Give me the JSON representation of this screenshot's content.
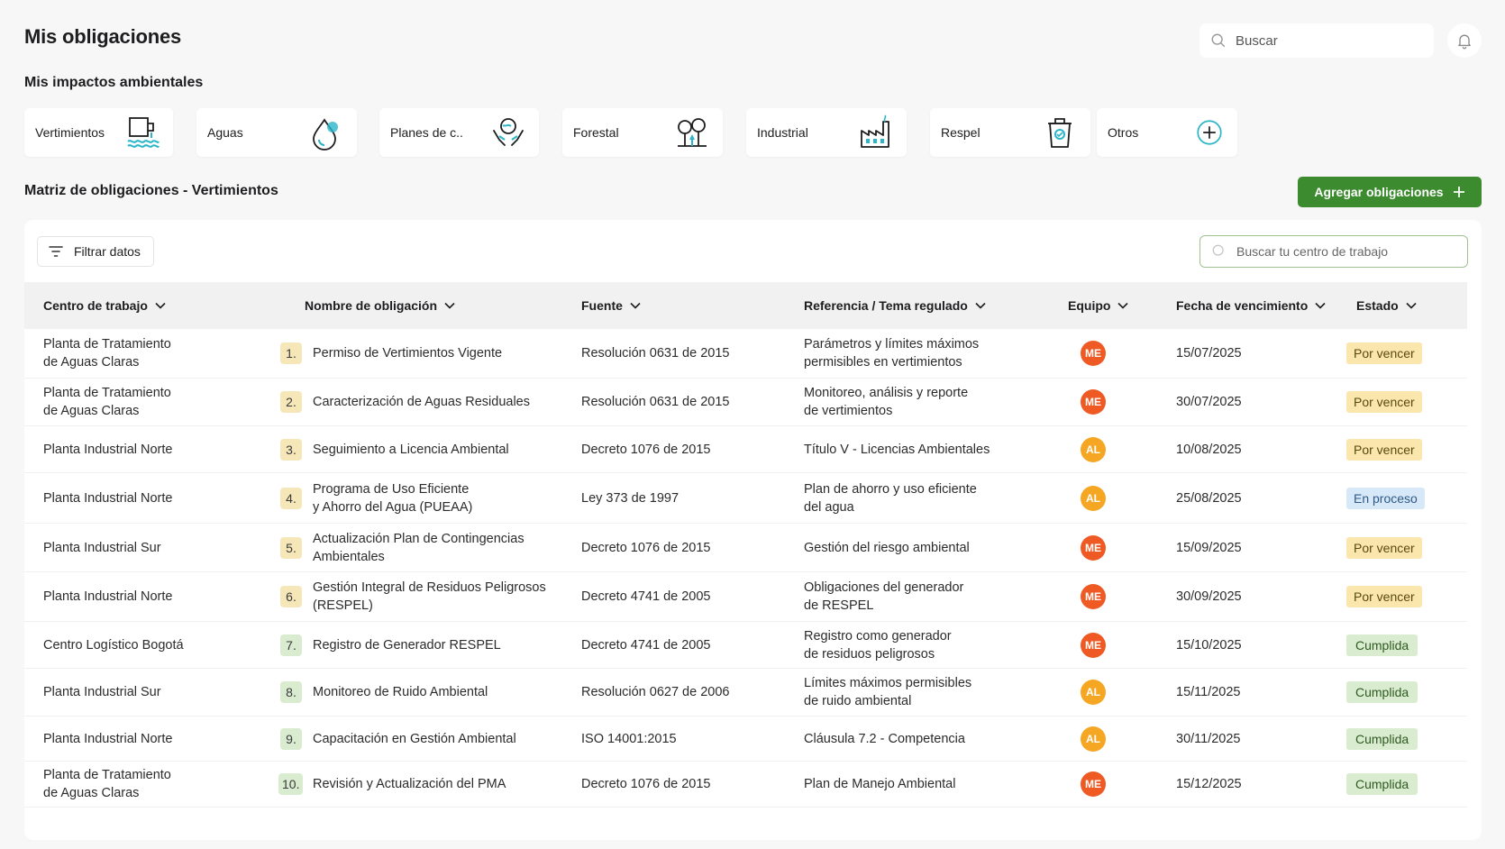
{
  "header": {
    "title": "Mis obligaciones",
    "search_placeholder": "Buscar"
  },
  "impacts": {
    "title": "Mis impactos ambientales",
    "tiles": [
      {
        "label": "Vertimientos",
        "icon": "water-discharge-icon"
      },
      {
        "label": "Aguas",
        "icon": "water-drop-icon"
      },
      {
        "label": "Planes de c..",
        "icon": "hands-globe-icon"
      },
      {
        "label": "Forestal",
        "icon": "trees-icon"
      },
      {
        "label": "Industrial",
        "icon": "factory-icon"
      },
      {
        "label": "Respel",
        "icon": "waste-bin-icon"
      },
      {
        "label": "Otros",
        "icon": "plus-circle-icon"
      }
    ]
  },
  "matrix": {
    "title": "Matriz de obligaciones - Vertimientos",
    "add_button_label": "Agregar obligaciones",
    "filter_label": "Filtrar datos",
    "search_placeholder": "Buscar tu centro de trabajo",
    "columns": [
      "Centro de trabajo",
      "Nombre de obligación",
      "Fuente",
      "Referencia / Tema regulado",
      "Equipo",
      "Fecha de vencimiento",
      "Estado"
    ],
    "rows": [
      {
        "centro": [
          "Planta de Tratamiento",
          "de Aguas Claras"
        ],
        "num": "1.",
        "nombre": [
          "Permiso de Vertimientos Vigente"
        ],
        "fuente": "Resolución 0631 de 2015",
        "referencia": [
          "Parámetros y límites máximos",
          "permisibles en vertimientos"
        ],
        "equipo": "ME",
        "fecha": "15/07/2025",
        "estado": "Por vencer"
      },
      {
        "centro": [
          "Planta de Tratamiento",
          "de Aguas Claras"
        ],
        "num": "2.",
        "nombre": [
          "Caracterización de Aguas Residuales"
        ],
        "fuente": "Resolución 0631 de 2015",
        "referencia": [
          "Monitoreo, análisis y reporte",
          "de vertimientos"
        ],
        "equipo": "ME",
        "fecha": "30/07/2025",
        "estado": "Por vencer"
      },
      {
        "centro": [
          "Planta Industrial Norte"
        ],
        "num": "3.",
        "nombre": [
          "Seguimiento a Licencia Ambiental"
        ],
        "fuente": "Decreto 1076 de 2015",
        "referencia": [
          "Título V - Licencias Ambientales"
        ],
        "equipo": "AL",
        "fecha": "10/08/2025",
        "estado": "Por vencer"
      },
      {
        "centro": [
          "Planta Industrial Norte"
        ],
        "num": "4.",
        "nombre": [
          "Programa de Uso Eficiente",
          "y Ahorro del Agua (PUEAA)"
        ],
        "fuente": "Ley 373 de 1997",
        "referencia": [
          "Plan de ahorro y uso eficiente",
          "del agua"
        ],
        "equipo": "AL",
        "fecha": "25/08/2025",
        "estado": "En proceso"
      },
      {
        "centro": [
          "Planta Industrial Sur"
        ],
        "num": "5.",
        "nombre": [
          "Actualización Plan de Contingencias",
          "Ambientales"
        ],
        "fuente": "Decreto 1076 de 2015",
        "referencia": [
          "Gestión del riesgo ambiental"
        ],
        "equipo": "ME",
        "fecha": "15/09/2025",
        "estado": "Por vencer"
      },
      {
        "centro": [
          "Planta Industrial Norte"
        ],
        "num": "6.",
        "nombre": [
          "Gestión Integral de Residuos Peligrosos",
          "(RESPEL)"
        ],
        "fuente": "Decreto 4741 de 2005",
        "referencia": [
          "Obligaciones del generador",
          "de RESPEL"
        ],
        "equipo": "ME",
        "fecha": "30/09/2025",
        "estado": "Por vencer"
      },
      {
        "centro": [
          "Centro Logístico Bogotá"
        ],
        "num": "7.",
        "nombre": [
          "Registro de Generador RESPEL"
        ],
        "fuente": "Decreto 4741 de 2005",
        "referencia": [
          "Registro como generador",
          "de residuos peligrosos"
        ],
        "equipo": "ME",
        "fecha": "15/10/2025",
        "estado": "Cumplida"
      },
      {
        "centro": [
          "Planta Industrial Sur"
        ],
        "num": "8.",
        "nombre": [
          "Monitoreo de Ruido Ambiental"
        ],
        "fuente": "Resolución 0627 de 2006",
        "referencia": [
          "Límites máximos permisibles",
          "de ruido ambiental"
        ],
        "equipo": "AL",
        "fecha": "15/11/2025",
        "estado": "Cumplida"
      },
      {
        "centro": [
          "Planta Industrial Norte"
        ],
        "num": "9.",
        "nombre": [
          "Capacitación en Gestión Ambiental"
        ],
        "fuente": "ISO 14001:2015",
        "referencia": [
          "Cláusula 7.2 - Competencia"
        ],
        "equipo": "AL",
        "fecha": "30/11/2025",
        "estado": "Cumplida"
      },
      {
        "centro": [
          "Planta de Tratamiento",
          "de Aguas Claras"
        ],
        "num": "10.",
        "nombre": [
          "Revisión y Actualización del PMA"
        ],
        "fuente": "Decreto 1076 de 2015",
        "referencia": [
          "Plan de Manejo Ambiental"
        ],
        "equipo": "ME",
        "fecha": "15/12/2025",
        "estado": "Cumplida"
      }
    ]
  },
  "colors": {
    "brand_green": "#3d8b2f",
    "icon_teal": "#2bb5c9",
    "avatar_me": "#ef5a24",
    "avatar_al": "#f5a623",
    "status_por_vencer_bg": "#fbe6ad",
    "status_en_proceso_bg": "#d7e9f8",
    "status_cumplida_bg": "#d9eccf"
  }
}
